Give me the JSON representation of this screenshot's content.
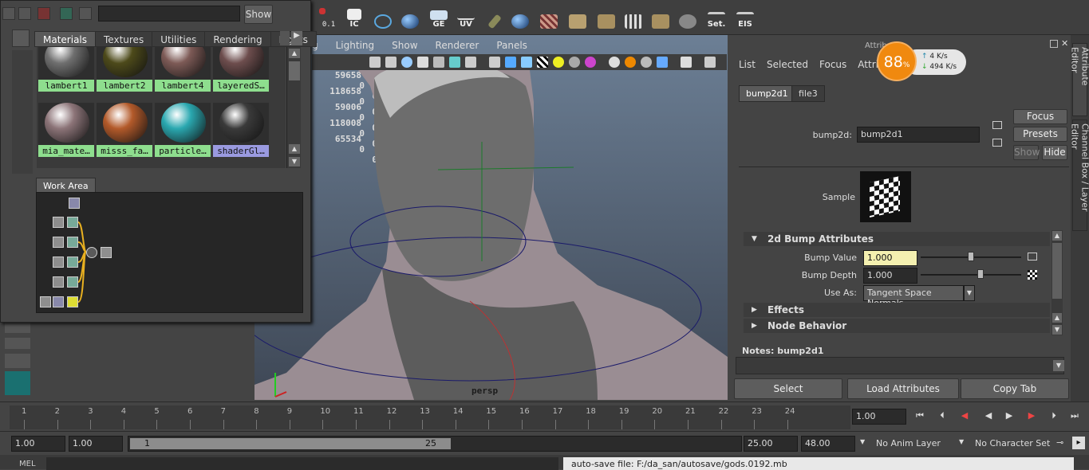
{
  "shelf": {
    "icons": [
      {
        "name": "snapping-icon",
        "label": ""
      },
      {
        "name": "ic-script-icon",
        "label": "IC"
      },
      {
        "name": "curve-icon",
        "label": ""
      },
      {
        "name": "sphere-icon",
        "label": ""
      },
      {
        "name": "ge-icon",
        "label": "GE"
      },
      {
        "name": "uv-icon",
        "label": "UV"
      },
      {
        "name": "tool-icon",
        "label": ""
      },
      {
        "name": "sphere-icon-2",
        "label": ""
      },
      {
        "name": "brick-icon",
        "label": ""
      },
      {
        "name": "crate-icon",
        "label": ""
      },
      {
        "name": "move-icon",
        "label": ""
      },
      {
        "name": "grid-icon",
        "label": ""
      },
      {
        "name": "boxes-icon",
        "label": ""
      },
      {
        "name": "globe-icon",
        "label": ""
      },
      {
        "name": "set-key-icon",
        "label": "Set."
      },
      {
        "name": "eis-key-icon",
        "label": "EIS"
      }
    ],
    "snap_label": "0.1"
  },
  "hypershade": {
    "show_label": "Show",
    "tabs": [
      "Materials",
      "Textures",
      "Utilities",
      "Rendering",
      "Lights"
    ],
    "materials": [
      {
        "label": "lambert1",
        "color": "#6f6f6f"
      },
      {
        "label": "lambert2",
        "color": "#4d4a1a"
      },
      {
        "label": "lambert4",
        "color": "#7d5a56"
      },
      {
        "label": "layeredS…",
        "color": "#6d4d4d"
      },
      {
        "label": "mia_mate…",
        "color": "#8c7478"
      },
      {
        "label": "misss_fa…",
        "color": "#b35a2a"
      },
      {
        "label": "particle…",
        "color": "#2aa8b0"
      },
      {
        "label": "shaderGl…",
        "color": "#3a3a3a"
      }
    ],
    "work_area_label": "Work Area"
  },
  "viewport": {
    "menu": [
      "g",
      "Lighting",
      "Show",
      "Renderer",
      "Panels"
    ],
    "hud": [
      {
        "a": "59658",
        "b": "0",
        "c": "0"
      },
      {
        "a": "118658",
        "b": "0",
        "c": "0"
      },
      {
        "a": "59006",
        "b": "0",
        "c": "0"
      },
      {
        "a": "118008",
        "b": "0",
        "c": "0"
      },
      {
        "a": "65534",
        "b": "0",
        "c": "0"
      }
    ],
    "camera_label": "persp"
  },
  "attribute_editor": {
    "title": "Attribute",
    "menu": [
      "List",
      "Selected",
      "Focus",
      "Attributes"
    ],
    "tabs": [
      "bump2d1",
      "file3"
    ],
    "node_label": "bump2d:",
    "node_value": "bump2d1",
    "focus_label": "Focus",
    "presets_label": "Presets",
    "show_label": "Show",
    "hide_label": "Hide",
    "sample_label": "Sample",
    "section_bump": "2d Bump Attributes",
    "bump_value_label": "Bump Value",
    "bump_value": "1.000",
    "bump_depth_label": "Bump Depth",
    "bump_depth": "1.000",
    "use_as_label": "Use As:",
    "use_as_value": "Tangent Space Normals",
    "section_effects": "Effects",
    "section_node_behavior": "Node Behavior",
    "notes_label": "Notes:  bump2d1",
    "select_label": "Select",
    "load_label": "Load Attributes",
    "copy_label": "Copy Tab"
  },
  "side_tabs": [
    "Attribute Editor",
    "Channel Box / Layer Editor"
  ],
  "net_monitor": {
    "percent": "88",
    "percent_suffix": "%",
    "up": "4 K/s",
    "down": "494 K/s"
  },
  "timeline": {
    "ticks": [
      "1",
      "2",
      "3",
      "4",
      "5",
      "6",
      "7",
      "8",
      "9",
      "10",
      "11",
      "12",
      "13",
      "14",
      "15",
      "16",
      "17",
      "18",
      "19",
      "20",
      "21",
      "22",
      "23",
      "24"
    ],
    "current_frame": "1.00"
  },
  "range": {
    "start": "1.00",
    "start2": "1.00",
    "slider_start": "1",
    "slider_end": "25",
    "end": "25.00",
    "end2": "48.00",
    "anim_layer": "No Anim Layer",
    "char_set": "No Character Set"
  },
  "command": {
    "mel_label": "MEL",
    "message": "auto-save file: F:/da_san/autosave/gods.0192.mb"
  }
}
